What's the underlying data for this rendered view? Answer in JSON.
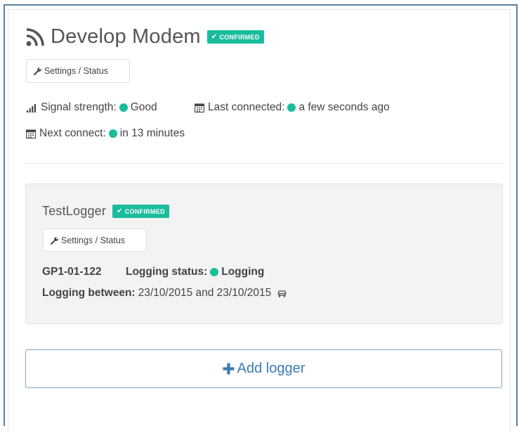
{
  "modem": {
    "title": "Develop Modem",
    "badge": "CONFIRMED",
    "settings_button": "Settings / Status",
    "signal_label": "Signal strength:",
    "signal_value": "Good",
    "last_connected_label": "Last connected:",
    "last_connected_value": "a few seconds ago",
    "next_connect_label": "Next connect:",
    "next_connect_value": "in 13 minutes"
  },
  "logger": {
    "title": "TestLogger",
    "badge": "CONFIRMED",
    "settings_button": "Settings / Status",
    "id": "GP1-01-122",
    "status_label": "Logging status:",
    "status_value": "Logging",
    "between_label": "Logging between:",
    "between_value": "23/10/2015 and 23/10/2015"
  },
  "add_logger": "Add logger",
  "colors": {
    "accent_green": "#1abc9c",
    "primary_blue": "#3b7ab5"
  },
  "icons": [
    "rss-icon",
    "check-icon",
    "wrench-icon",
    "signal-icon",
    "calendar-icon",
    "car-icon",
    "plus-icon"
  ]
}
